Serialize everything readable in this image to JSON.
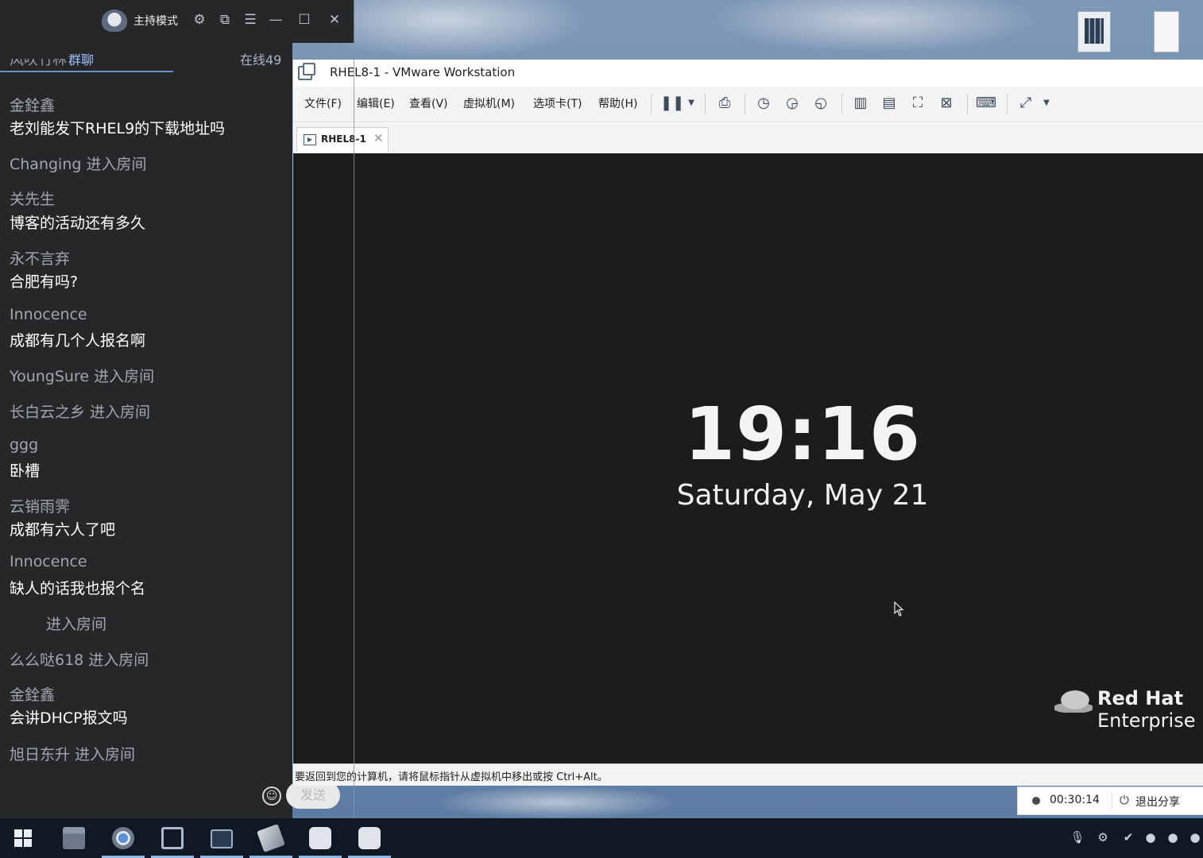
{
  "chat": {
    "host_mode": "主持模式",
    "tab_group": "群聊",
    "tab_online": "在线49",
    "clipped_top": "风吹竹林",
    "messages": [
      {
        "name": "金銓鑫",
        "text": "老刘能发下RHEL9的下载地址吗"
      },
      {
        "system": "Changing 进入房间"
      },
      {
        "name": "关先生",
        "text": "博客的活动还有多久"
      },
      {
        "name": "永不言弃",
        "text": "合肥有吗?"
      },
      {
        "name": "Innocence",
        "text": "成都有几个人报名啊"
      },
      {
        "system": "YoungSure 进入房间"
      },
      {
        "system": "长白云之乡 进入房间"
      },
      {
        "name": "ggg",
        "text": "卧槽"
      },
      {
        "name": "云销雨霁",
        "text": "成都有六人了吧"
      },
      {
        "name": "Innocence",
        "text": "缺人的话我也报个名"
      },
      {
        "system": "进入房间"
      },
      {
        "system": "么么哒618 进入房间"
      },
      {
        "name": "金銓鑫",
        "text": "会讲DHCP报文吗"
      },
      {
        "system": "旭日东升 进入房间"
      }
    ],
    "send_label": "发送"
  },
  "vmware": {
    "title": "RHEL8-1 - VMware Workstation",
    "menu": [
      "文件(F)",
      "编辑(E)",
      "查看(V)",
      "虚拟机(M)",
      "选项卡(T)",
      "帮助(H)"
    ],
    "tab_label": "RHEL8-1",
    "status_text": "要返回到您的计算机，请将鼠标指针从虚拟机中移出或按 Ctrl+Alt。"
  },
  "guest": {
    "time": "19:16",
    "date": "Saturday, May 21",
    "brand_line1": "Red Hat",
    "brand_line2": "Enterprise L"
  },
  "share": {
    "elapsed": "00:30:14",
    "exit_label": "退出分享"
  },
  "taskbar": {
    "apps": [
      "file-explorer",
      "chrome",
      "vmware-workstation",
      "screen-share",
      "tool-app",
      "app-c1",
      "app-c2"
    ]
  }
}
